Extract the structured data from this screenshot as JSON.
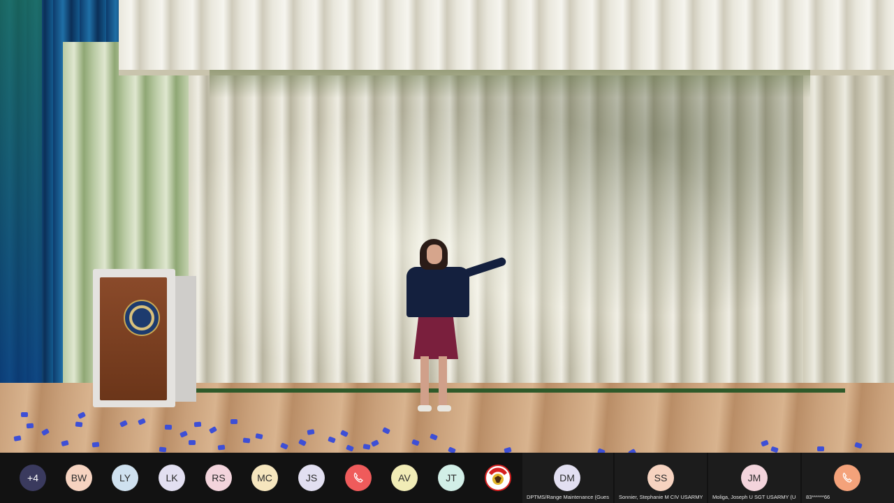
{
  "participants_bar": {
    "overflow_count": "+4",
    "avatars": [
      {
        "initials": "BW",
        "color": "#f6d3c0"
      },
      {
        "initials": "LY",
        "color": "#cfe1ef"
      },
      {
        "initials": "LK",
        "color": "#e2dff1"
      },
      {
        "initials": "RS",
        "color": "#f3d4dc"
      },
      {
        "initials": "MC",
        "color": "#f6e6be"
      },
      {
        "initials": "JS",
        "color": "#e2dff1"
      },
      {
        "initials": "",
        "color": "#ef5b5b",
        "icon": "phone-icon"
      },
      {
        "initials": "AV",
        "color": "#f1ecb6"
      },
      {
        "initials": "JT",
        "color": "#d2efe7"
      },
      {
        "initials": "",
        "color": "#ffffff",
        "icon": "mascot-logo-icon"
      }
    ],
    "named_tiles": [
      {
        "initials": "DM",
        "color": "#e2dff1",
        "name": "DPTMS/Range Maintenance (Guest)"
      },
      {
        "initials": "SS",
        "color": "#f6d3c0",
        "name": "Sonnier, Stephanie M CIV USARMY..."
      },
      {
        "initials": "JM",
        "color": "#f3d4dc",
        "name": "Moliga, Joseph U SGT USARMY (USA)"
      },
      {
        "initials": "",
        "color": "#f4a27a",
        "icon": "phone-icon",
        "name": "83******66"
      }
    ]
  }
}
